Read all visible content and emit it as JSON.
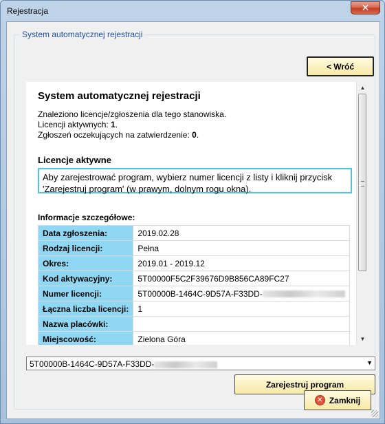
{
  "window": {
    "title": "Rejestracja",
    "close_glyph": "✕"
  },
  "group": {
    "legend": "System automatycznej rejestracji"
  },
  "buttons": {
    "back": "< Wróć",
    "register": "Zarejestruj program",
    "close": "Zamknij"
  },
  "content": {
    "heading": "System automatycznej rejestracji",
    "info_line1": "Znaleziono licencje/zgłoszenia dla tego stanowiska.",
    "active_label": "Licencji aktywnych: ",
    "active_count": "1",
    "pending_label": "Zgłoszeń oczekujących na zatwierdzenie: ",
    "pending_count": "0",
    "active_heading": "Licencje aktywne",
    "notice": "Aby zarejestrować program, wybierz numer licencji z listy i kliknij przycisk 'Zarejestruj program' (w prawym, dolnym rogu okna).",
    "details_heading": "Informacje szczegółowe:",
    "details": [
      {
        "key": "Data zgłoszenia:",
        "value": "2019.02.28"
      },
      {
        "key": "Rodzaj licencji:",
        "value": "Pełna"
      },
      {
        "key": "Okres:",
        "value": "2019.01 - 2019.12"
      },
      {
        "key": "Kod aktywacyjny:",
        "value": "5T00000F5C2F39676D9B856CA89FC27"
      },
      {
        "key": "Numer licencji:",
        "value": "5T00000B-1464C-9D57A-F33DD-"
      },
      {
        "key": "Łączna liczba licencji:",
        "value": "1"
      },
      {
        "key": "Nazwa placówki:",
        "value": ""
      },
      {
        "key": "Miejscowość:",
        "value": "Zielona Góra"
      }
    ]
  },
  "license_select": {
    "selected": "5T00000B-1464C-9D57A-F33DD-"
  },
  "icons": {
    "close_icon": "x-circle-icon",
    "scroll_up": "triangle-up-icon",
    "scroll_down": "triangle-down-icon"
  },
  "colors": {
    "label_cell": "#8fd7f2",
    "notice_border": "#4cc3e0",
    "button_fill": "#f7e9a6"
  }
}
